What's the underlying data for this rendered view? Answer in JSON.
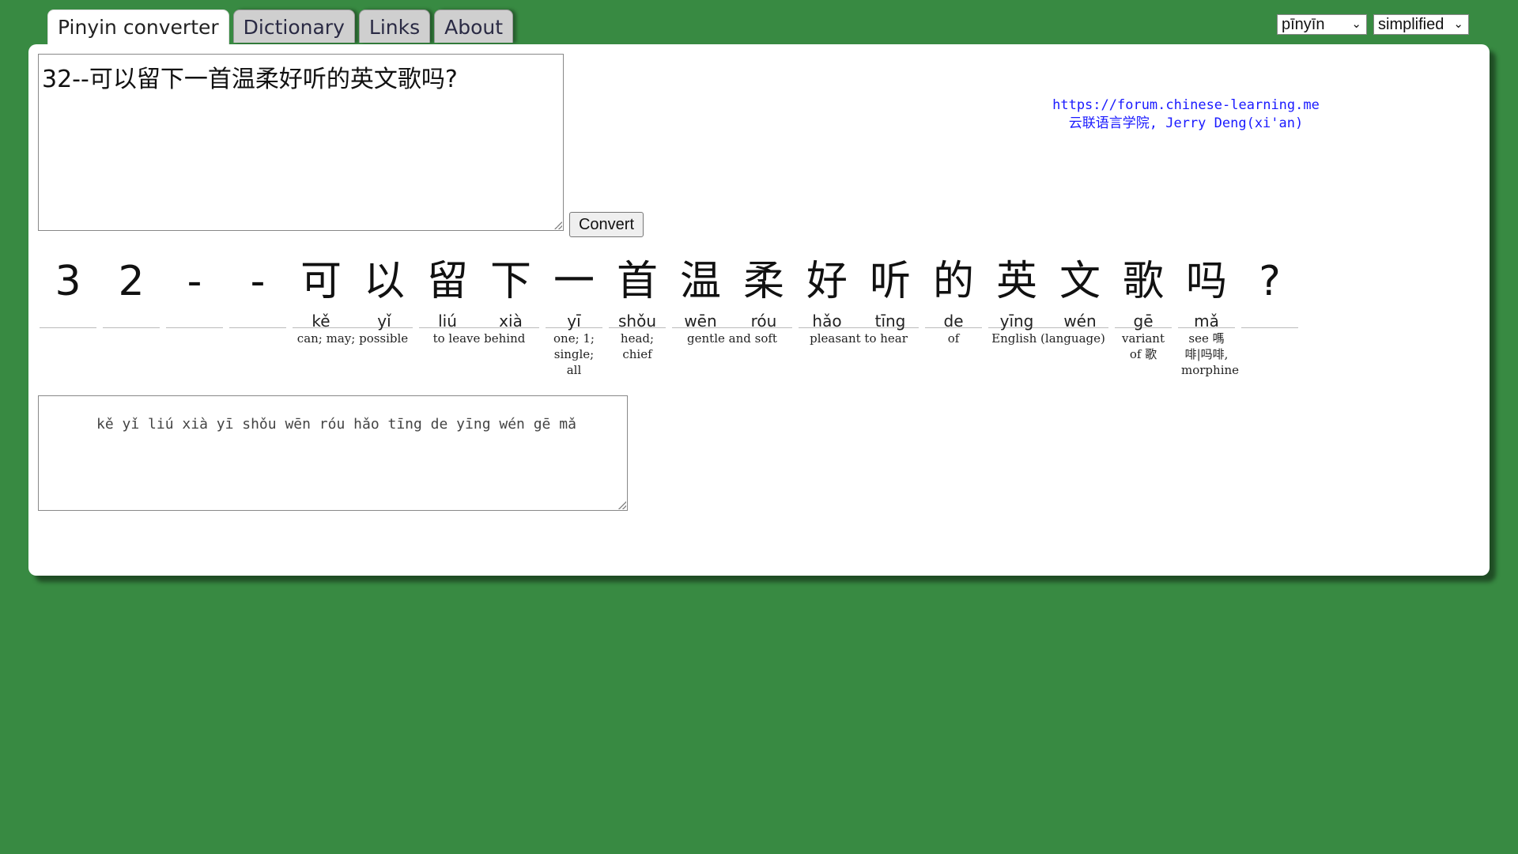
{
  "tabs": [
    {
      "label": "Pinyin converter"
    },
    {
      "label": "Dictionary"
    },
    {
      "label": "Links"
    },
    {
      "label": "About"
    }
  ],
  "selects": {
    "pinyin_mode": "pīnyīn",
    "script_mode": "simplified"
  },
  "input": {
    "value": "32--可以留下一首温柔好听的英文歌吗?"
  },
  "convert_label": "Convert",
  "credits": {
    "line1": "https://forum.chinese-learning.me",
    "line2": "云联语言学院, Jerry Deng(xi'an)"
  },
  "segments": [
    {
      "chars": [
        {
          "hz": "3",
          "py": ""
        }
      ],
      "def": ""
    },
    {
      "chars": [
        {
          "hz": "2",
          "py": ""
        }
      ],
      "def": ""
    },
    {
      "chars": [
        {
          "hz": "-",
          "py": ""
        }
      ],
      "def": ""
    },
    {
      "chars": [
        {
          "hz": "-",
          "py": ""
        }
      ],
      "def": ""
    },
    {
      "chars": [
        {
          "hz": "可",
          "py": "kě"
        },
        {
          "hz": "以",
          "py": "yǐ"
        }
      ],
      "def": "can; may; possible"
    },
    {
      "chars": [
        {
          "hz": "留",
          "py": "liú"
        },
        {
          "hz": "下",
          "py": "xià"
        }
      ],
      "def": "to leave behind"
    },
    {
      "chars": [
        {
          "hz": "一",
          "py": "yī"
        }
      ],
      "def": "one; 1; single; all"
    },
    {
      "chars": [
        {
          "hz": "首",
          "py": "shǒu"
        }
      ],
      "def": "head; chief"
    },
    {
      "chars": [
        {
          "hz": "温",
          "py": "wēn"
        },
        {
          "hz": "柔",
          "py": "róu"
        }
      ],
      "def": "gentle and soft"
    },
    {
      "chars": [
        {
          "hz": "好",
          "py": "hǎo"
        },
        {
          "hz": "听",
          "py": "tīng"
        }
      ],
      "def": "pleasant to hear"
    },
    {
      "chars": [
        {
          "hz": "的",
          "py": "de"
        }
      ],
      "def": "of"
    },
    {
      "chars": [
        {
          "hz": "英",
          "py": "yīng"
        },
        {
          "hz": "文",
          "py": "wén"
        }
      ],
      "def": "English (language)"
    },
    {
      "chars": [
        {
          "hz": "歌",
          "py": "gē"
        }
      ],
      "def": "variant of 歌"
    },
    {
      "chars": [
        {
          "hz": "吗",
          "py": "mǎ"
        }
      ],
      "def": "see 嗎啡|吗啡, morphine"
    },
    {
      "chars": [
        {
          "hz": "?",
          "py": ""
        }
      ],
      "def": ""
    }
  ],
  "output": {
    "value": "  kě yǐ liú xià yī shǒu wēn róu hǎo tīng de yīng wén gē mǎ"
  }
}
